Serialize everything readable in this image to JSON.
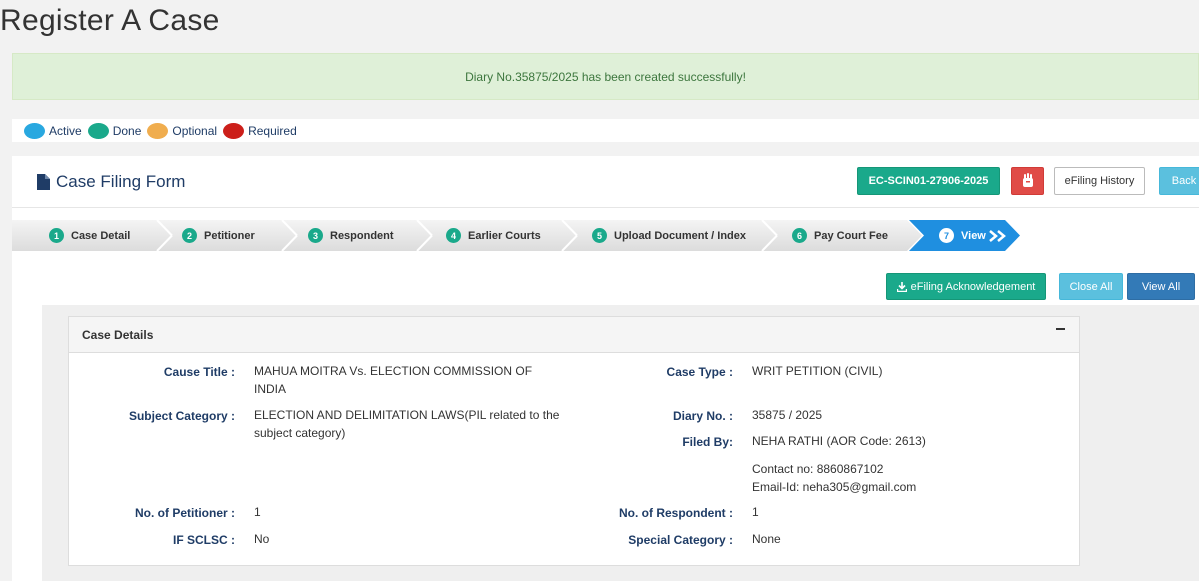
{
  "page": {
    "title": "Register A Case"
  },
  "alert": {
    "message": "Diary No.35875/2025 has been created successfully!"
  },
  "legend": [
    {
      "label": "Active",
      "color": "#29a8e0"
    },
    {
      "label": "Done",
      "color": "#1aa98b"
    },
    {
      "label": "Optional",
      "color": "#f0ad4e"
    },
    {
      "label": "Required",
      "color": "#cc1f1a"
    }
  ],
  "form": {
    "title": "Case Filing Form",
    "code_label": "EC-SCIN01-27906-2025",
    "history_label": "eFiling History",
    "back_label": "Back",
    "ack_label": "eFiling Acknowledgement",
    "close_all_label": "Close All",
    "view_all_label": "View All"
  },
  "steps": [
    {
      "num": "1",
      "label": "Case Detail"
    },
    {
      "num": "2",
      "label": "Petitioner"
    },
    {
      "num": "3",
      "label": "Respondent"
    },
    {
      "num": "4",
      "label": "Earlier Courts"
    },
    {
      "num": "5",
      "label": "Upload Document / Index"
    },
    {
      "num": "6",
      "label": "Pay Court Fee"
    },
    {
      "num": "7",
      "label": "View"
    }
  ],
  "details": {
    "heading": "Case Details",
    "cause_title_label": "Cause Title :",
    "cause_title_line1": "MAHUA MOITRA Vs. ELECTION COMMISSION OF",
    "cause_title_line2": "INDIA",
    "subject_category_label": "Subject Category :",
    "subject_category_line1": "ELECTION AND DELIMITATION LAWS(PIL related to the",
    "subject_category_line2": "subject category)",
    "petitioners_label": "No. of Petitioner :",
    "petitioners_value": "1",
    "sclsc_label": "IF SCLSC :",
    "sclsc_value": "No",
    "case_type_label": "Case Type :",
    "case_type_value": "WRIT PETITION (CIVIL)",
    "diary_label": "Diary No. :",
    "diary_value": "35875 / 2025",
    "filed_by_label": "Filed By:",
    "filed_by_value": "NEHA RATHI (AOR Code: 2613)",
    "contact_value": "Contact no: 8860867102",
    "email_value": "Email-Id: neha305@gmail.com",
    "respondents_label": "No. of Respondent :",
    "respondents_value": "1",
    "special_category_label": "Special Category :",
    "special_category_value": "None"
  }
}
